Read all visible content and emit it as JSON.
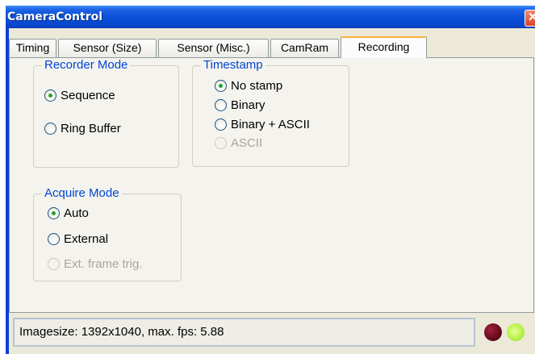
{
  "window": {
    "title": "CameraControl",
    "close_glyph": "✕"
  },
  "tabs": [
    {
      "label": "Timing",
      "active": false
    },
    {
      "label": "Sensor (Size)",
      "active": false
    },
    {
      "label": "Sensor (Misc.)",
      "active": false
    },
    {
      "label": "CamRam",
      "active": false
    },
    {
      "label": "Recording",
      "active": true
    }
  ],
  "recorder_mode": {
    "title": "Recorder Mode",
    "options": [
      {
        "label": "Sequence",
        "selected": true,
        "enabled": true
      },
      {
        "label": "Ring Buffer",
        "selected": false,
        "enabled": true
      }
    ]
  },
  "timestamp": {
    "title": "Timestamp",
    "options": [
      {
        "label": "No stamp",
        "selected": true,
        "enabled": true
      },
      {
        "label": "Binary",
        "selected": false,
        "enabled": true
      },
      {
        "label": "Binary + ASCII",
        "selected": false,
        "enabled": true
      },
      {
        "label": "ASCII",
        "selected": false,
        "enabled": false
      }
    ]
  },
  "acquire_mode": {
    "title": "Acquire Mode",
    "options": [
      {
        "label": "Auto",
        "selected": true,
        "enabled": true
      },
      {
        "label": "External",
        "selected": false,
        "enabled": true
      },
      {
        "label": "Ext. frame trig.",
        "selected": false,
        "enabled": false
      }
    ]
  },
  "status": {
    "text": "Imagesize: 1392x1040, max. fps: 5.88"
  },
  "indicators": {
    "red": {
      "color": "#6a0c1d",
      "icon": "red-led-icon"
    },
    "green": {
      "color": "#b7f24a",
      "icon": "green-led-icon"
    }
  },
  "colors": {
    "titlebar": "#0a4fd8",
    "legend_text": "#0046d5",
    "radio_dot": "#22a32a",
    "active_tab_accent": "#f9b43a"
  }
}
